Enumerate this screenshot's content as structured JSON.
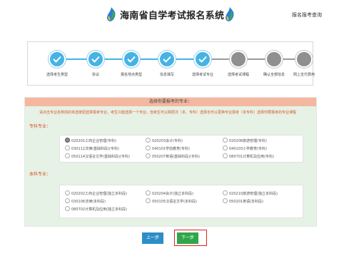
{
  "header": {
    "title": "海南省自学考试报名系统",
    "query_link": "报名报考查询",
    "logo_icon": "flame-logo-icon"
  },
  "steps": [
    {
      "label": "选择考生类型",
      "state": "done"
    },
    {
      "label": "协议",
      "state": "done"
    },
    {
      "label": "报名地点类型",
      "state": "done"
    },
    {
      "label": "信息填写",
      "state": "done"
    },
    {
      "label": "选择考试专业",
      "state": "done"
    },
    {
      "label": "选择考试课程",
      "state": "todo"
    },
    {
      "label": "确认全部信息",
      "state": "todo"
    },
    {
      "label": "网上支付费用",
      "state": "todo"
    }
  ],
  "panel": {
    "title": "选择你要报考的专业：",
    "notice": "请点击专业名称前的单选按钮选择报考专业，考生只能选择一个专业，但考生可以跨层次（本、专科）选择也可以更换专业报考（本专科）选择你要报考的专业课程",
    "sections": [
      {
        "label": "专科专业：",
        "options": [
          {
            "text": "020201工商企业管理(专科)",
            "selected": true
          },
          {
            "text": "020203会计(专科)",
            "selected": false
          },
          {
            "text": "020208旅游管理(专科)",
            "selected": false
          },
          {
            "text": "030112法律(基础科段)(专科)",
            "selected": false
          },
          {
            "text": "040101学前教育(专科)",
            "selected": false
          },
          {
            "text": "040103小学教育(专科)",
            "selected": false
          },
          {
            "text": "050114汉语言文学(基础科段)(专科)",
            "selected": false
          },
          {
            "text": "050207英语(基础科段)(专科)",
            "selected": false
          },
          {
            "text": "080701计算机及应用(专科)",
            "selected": false
          }
        ]
      },
      {
        "label": "本科专业：",
        "options": [
          {
            "text": "020202工商企业管理(独立本科段)",
            "selected": false
          },
          {
            "text": "020204会计(独立本科段)",
            "selected": false
          },
          {
            "text": "020210旅游管理(独立本科段)",
            "selected": false
          },
          {
            "text": "030106法律(本科段)",
            "selected": false
          },
          {
            "text": "050105汉语言文学(本科段)",
            "selected": false
          },
          {
            "text": "050201英语(本科段)",
            "selected": false
          },
          {
            "text": "080702计算机及应用(独立本科段)",
            "selected": false
          }
        ]
      }
    ]
  },
  "buttons": {
    "prev": "上一步",
    "next": "下一步"
  },
  "colors": {
    "step_done": "#46b3e4",
    "step_todo": "#8f8f8f",
    "panel_head": "#f4b7a0",
    "panel_body": "#e5f2e5",
    "notice_text": "#e0522a",
    "prev_button": "#2d8ec7",
    "next_button": "#2ea74a",
    "highlight_outline": "#e02222"
  }
}
